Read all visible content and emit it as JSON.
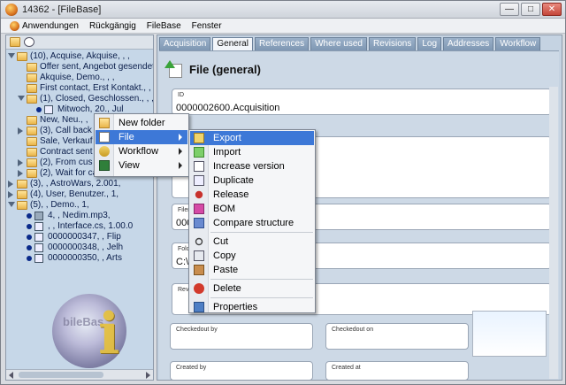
{
  "window": {
    "title": "14362 - [FileBase]",
    "min_label": "—",
    "max_label": "□",
    "close_label": "✕"
  },
  "menubar": [
    "Anwendungen",
    "Rückgängig",
    "FileBase",
    "Fenster"
  ],
  "tree": [
    {
      "label": "(10), Acquise, Akquise, , ,",
      "indent": 0,
      "expander": "open",
      "icon": "folder"
    },
    {
      "label": "Offer sent, Angebot gesendet",
      "indent": 1,
      "expander": "",
      "icon": "folder"
    },
    {
      "label": "Akquise, Demo., , ,",
      "indent": 1,
      "expander": "",
      "icon": "folder"
    },
    {
      "label": "First contact, Erst Kontakt., ,",
      "indent": 1,
      "expander": "",
      "icon": "folder"
    },
    {
      "label": "(1), Closed, Geschlossen., , ,",
      "indent": 1,
      "expander": "open",
      "icon": "folder"
    },
    {
      "label": "Mitwoch, 20., Jul",
      "indent": 2,
      "expander": "",
      "icon": "item"
    },
    {
      "label": "New, Neu., ,",
      "indent": 1,
      "expander": "",
      "icon": "folder"
    },
    {
      "label": "(3), Call back",
      "indent": 1,
      "expander": "closed",
      "icon": "folder"
    },
    {
      "label": "Sale, Verkauf",
      "indent": 1,
      "expander": "",
      "icon": "folder"
    },
    {
      "label": "Contract sent",
      "indent": 1,
      "expander": "",
      "icon": "folder"
    },
    {
      "label": "(2), From cus",
      "indent": 1,
      "expander": "closed",
      "icon": "folder"
    },
    {
      "label": "(2), Wait for callback, Wart",
      "indent": 1,
      "expander": "closed",
      "icon": "folder"
    },
    {
      "label": "(3), , AstroWars, 2.001,",
      "indent": 0,
      "expander": "closed",
      "icon": "folder"
    },
    {
      "label": "(4), User, Benutzer., 1,",
      "indent": 0,
      "expander": "closed",
      "icon": "folder"
    },
    {
      "label": "(5), , Demo., 1,",
      "indent": 0,
      "expander": "open",
      "icon": "folder"
    },
    {
      "label": "4, , Nedim.mp3,",
      "indent": 1,
      "expander": "",
      "icon": "media"
    },
    {
      "label": ", , Interface.cs, 1.00.0",
      "indent": 1,
      "expander": "",
      "icon": "item"
    },
    {
      "label": "0000000347, , Flip",
      "indent": 1,
      "expander": "",
      "icon": "item"
    },
    {
      "label": "0000000348, , Jelh",
      "indent": 1,
      "expander": "",
      "icon": "item"
    },
    {
      "label": "0000000350, , Arts",
      "indent": 1,
      "expander": "",
      "icon": "item"
    }
  ],
  "watermark": {
    "text": "bileBas"
  },
  "tabs": [
    "Acquisition",
    "General",
    "References",
    "Where used",
    "Revisions",
    "Log",
    "Addresses",
    "Workflow"
  ],
  "active_tab": "General",
  "page_title": "File (general)",
  "fields": {
    "id_label": "ID",
    "id_value": "0000002600.Acquisition",
    "filename_label": "Filen",
    "filename_value": "000",
    "folder_label": "Fold",
    "folder_value": "C:\\",
    "revision_label": "Revis",
    "checkedout_by_label": "Checkedout by",
    "checkedout_on_label": "Checkedout on",
    "created_by_label": "Created by",
    "created_at_label": "Created at"
  },
  "context_menu": [
    {
      "label": "New folder",
      "icon": "folder",
      "submenu": false
    },
    {
      "label": "File",
      "icon": "file",
      "submenu": true,
      "highlighted": true
    },
    {
      "label": "Workflow",
      "icon": "workflow",
      "submenu": true
    },
    {
      "label": "View",
      "icon": "view",
      "submenu": true
    }
  ],
  "file_submenu": [
    {
      "label": "Export",
      "icon": "export",
      "highlighted": true
    },
    {
      "label": "Import",
      "icon": "import"
    },
    {
      "label": "Increase version",
      "icon": "version"
    },
    {
      "label": "Duplicate",
      "icon": "duplicate"
    },
    {
      "label": "Release",
      "icon": "release"
    },
    {
      "label": "BOM",
      "icon": "bom"
    },
    {
      "label": "Compare structure",
      "icon": "compare"
    },
    {
      "label": "Cut",
      "icon": "cut"
    },
    {
      "label": "Copy",
      "icon": "copy"
    },
    {
      "label": "Paste",
      "icon": "paste"
    },
    {
      "label": "Delete",
      "icon": "delete"
    },
    {
      "label": "Properties",
      "icon": "properties"
    }
  ]
}
